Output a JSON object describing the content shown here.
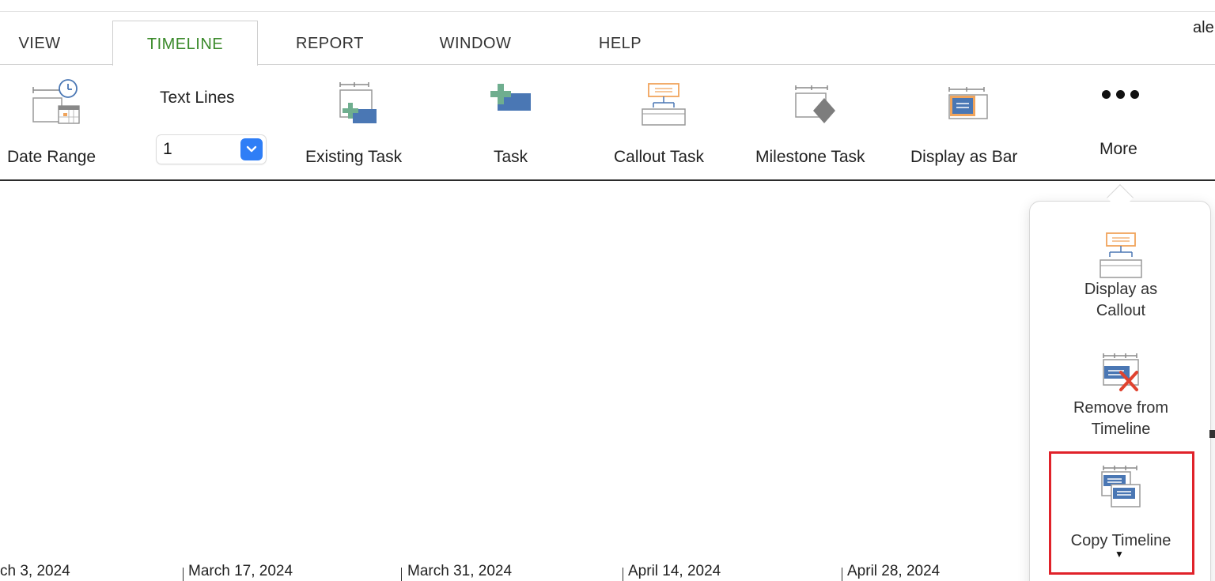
{
  "tabs": [
    {
      "label": "VIEW",
      "active": false
    },
    {
      "label": "TIMELINE",
      "active": true
    },
    {
      "label": "REPORT",
      "active": false
    },
    {
      "label": "WINDOW",
      "active": false
    },
    {
      "label": "HELP",
      "active": false
    }
  ],
  "user": {
    "name_partial": "ale"
  },
  "ribbon": {
    "date_range": "Date Range",
    "text_lines_label": "Text Lines",
    "text_lines_value": "1",
    "existing_task": "Existing Task",
    "task": "Task",
    "callout_task": "Callout Task",
    "milestone_task": "Milestone Task",
    "display_as_bar": "Display as Bar",
    "more": "More"
  },
  "more_menu": {
    "display_as_callout_1": "Display as",
    "display_as_callout_2": "Callout",
    "remove_from_timeline_1": "Remove from",
    "remove_from_timeline_2": "Timeline",
    "copy_timeline": "Copy Timeline"
  },
  "timeline": {
    "dates": [
      "ch 3, 2024",
      "March 17, 2024",
      "March 31, 2024",
      "April 14, 2024",
      "April 28, 2024"
    ]
  },
  "colors": {
    "accent_green": "#3b8a2b",
    "task_blue": "#4a77b4",
    "plus_green": "#6fae8f",
    "callout_orange": "#f0a45c",
    "milestone_gray": "#7d7d7d",
    "select_blue": "#2f7ef6",
    "highlight_red": "#e0222a",
    "remove_red": "#e0432f"
  },
  "icons": {
    "date_range": "date-range-icon",
    "existing_task": "existing-task-icon",
    "task": "task-icon",
    "callout_task": "callout-task-icon",
    "milestone_task": "milestone-task-icon",
    "display_as_bar": "display-as-bar-icon",
    "more": "ellipsis-icon"
  }
}
